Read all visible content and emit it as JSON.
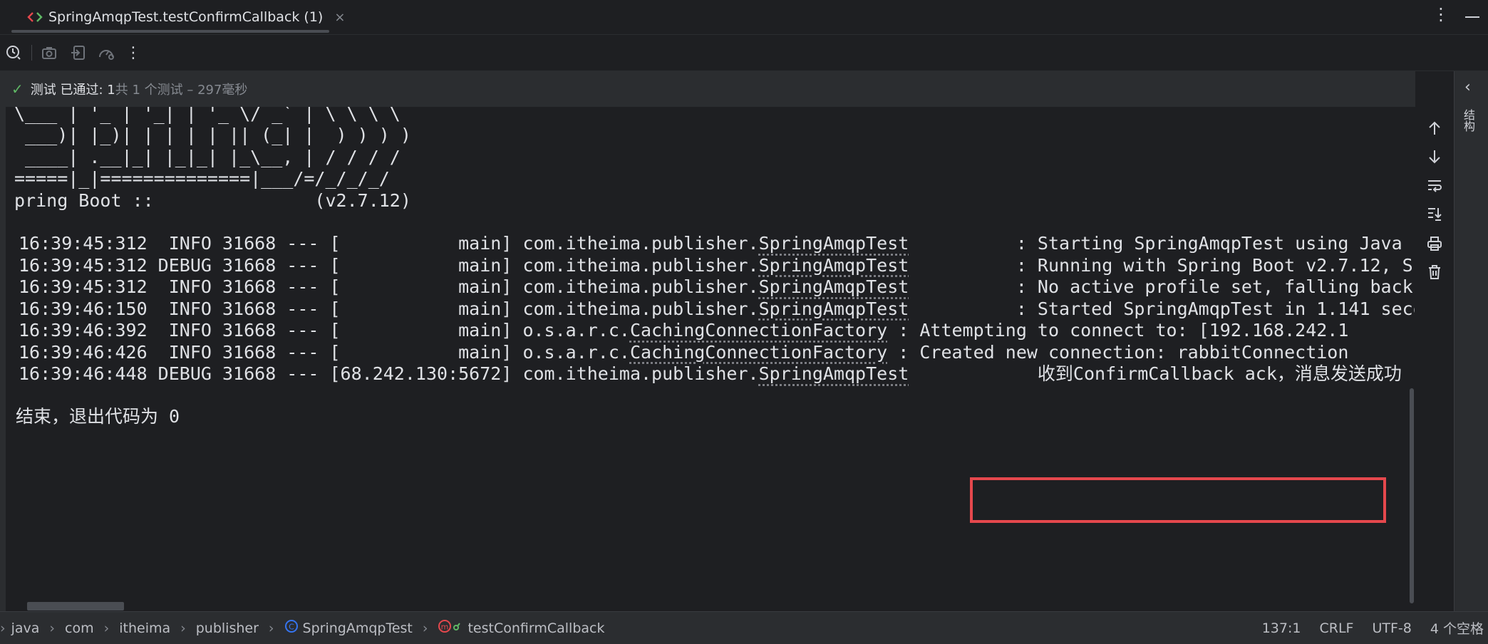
{
  "tab": {
    "title": "SpringAmqpTest.testConfirmCallback (1)",
    "close": "×"
  },
  "status": {
    "passed": "测试 已通过: 1",
    "summary": "共 1 个测试 – 297毫秒"
  },
  "console": {
    "banner": [
      "' ___'_ __ _ _(_)_ __  __ _ \\ \\ \\ \\",
      "\\___ | '_ | '_| | '_ \\/ _` | \\ \\ \\ \\",
      " ___)| |_)| | | | | || (_| |  ) ) ) )",
      " ____| .__|_| |_|_| |_\\__, | / / / /",
      "=====|_|==============|___/=/_/_/_/",
      "pring Boot ::               (v2.7.12)"
    ],
    "logs": [
      {
        "time": "16:39:45:312",
        "level": " INFO",
        "pid": "31668",
        "thread": "[           main]",
        "pkg": "com.itheima.publisher.",
        "cls": "SpringAmqpTest",
        "pad": "     ",
        "msg": ": Starting SpringAmqpTest using Java 11.0."
      },
      {
        "time": "16:39:45:312",
        "level": "DEBUG",
        "pid": "31668",
        "thread": "[           main]",
        "pkg": "com.itheima.publisher.",
        "cls": "SpringAmqpTest",
        "pad": "     ",
        "msg": ": Running with Spring Boot v2.7.12, Spring"
      },
      {
        "time": "16:39:45:312",
        "level": " INFO",
        "pid": "31668",
        "thread": "[           main]",
        "pkg": "com.itheima.publisher.",
        "cls": "SpringAmqpTest",
        "pad": "     ",
        "msg": ": No active profile set, falling back to 1"
      },
      {
        "time": "16:39:46:150",
        "level": " INFO",
        "pid": "31668",
        "thread": "[           main]",
        "pkg": "com.itheima.publisher.",
        "cls": "SpringAmqpTest",
        "pad": "     ",
        "msg": ": Started SpringAmqpTest in 1.141 seconds"
      },
      {
        "time": "16:39:46:392",
        "level": " INFO",
        "pid": "31668",
        "thread": "[           main]",
        "pkg": "o.s.a.r.c.",
        "cls": "CachingConnectionFactory",
        "pad": "     ",
        "msg": ": Attempting to connect to: [192.168.242.1"
      },
      {
        "time": "16:39:46:426",
        "level": " INFO",
        "pid": "31668",
        "thread": "[           main]",
        "pkg": "o.s.a.r.c.",
        "cls": "CachingConnectionFactory",
        "pad": "     ",
        "msg": ": Created new connection: rabbitConnection"
      },
      {
        "time": "16:39:46:448",
        "level": "DEBUG",
        "pid": "31668",
        "thread": "[68.242.130:5672]",
        "pkg": "com.itheima.publisher.",
        "cls": "SpringAmqpTest",
        "pad": "     ",
        "msg": "  收到ConfirmCallback ack，消息发送成功"
      }
    ],
    "exit": "结束，退出代码为 0"
  },
  "sidebar_label": "结构",
  "breadcrumbs": [
    "java",
    "com",
    "itheima",
    "publisher",
    "SpringAmqpTest",
    "testConfirmCallback"
  ],
  "statusbar": {
    "position": "137:1",
    "line_ending": "CRLF",
    "encoding": "UTF-8",
    "indent": "4 个空格"
  },
  "colors": {
    "highlight": "#e5484d",
    "pass": "#5fb865",
    "accent": "#3574f0"
  }
}
